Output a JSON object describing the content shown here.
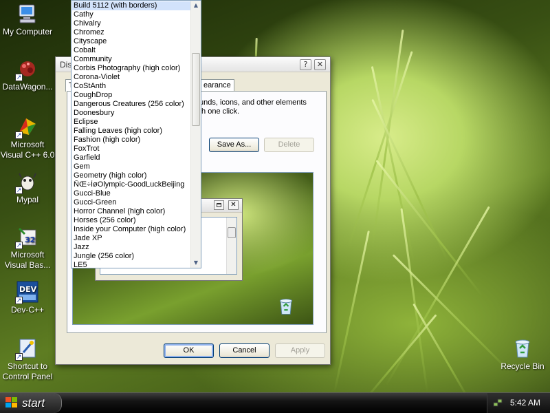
{
  "desktop": {
    "icons": [
      {
        "label": "My Computer",
        "icon": "my-computer-icon"
      },
      {
        "label": "DataWagon...",
        "icon": "datawagon-icon"
      },
      {
        "label": "Microsoft Visual C++ 6.0",
        "icon": "visual-cpp-icon"
      },
      {
        "label": "Mypal",
        "icon": "mypal-icon"
      },
      {
        "label": "Microsoft Visual Bas...",
        "icon": "visual-basic-icon"
      },
      {
        "label": "Dev-C++",
        "icon": "dev-cpp-icon"
      },
      {
        "label": "Shortcut to Control Panel",
        "icon": "control-panel-icon"
      },
      {
        "label": "Recycle Bin",
        "icon": "recycle-bin-icon"
      }
    ]
  },
  "dialog": {
    "title": "Dis",
    "help_button": "?",
    "close_button": "✕",
    "tab_left_fragment": "T",
    "tab_appearance_fragment": "earance",
    "description_line1": "unds, icons, and other elements",
    "description_line2": "th one click.",
    "save_as_label": "Save As...",
    "delete_label": "Delete",
    "ok_label": "OK",
    "cancel_label": "Cancel",
    "apply_label": "Apply"
  },
  "theme_dropdown": {
    "selected": "Build 5112 (with borders)",
    "options": [
      "Build 5112 (with borders)",
      "Cathy",
      "Chivalry",
      "Chromez",
      "Cityscape",
      "Cobalt",
      "Community",
      "Corbis Photography (high color)",
      "Corona-Violet",
      "CoStAnth",
      "CoughDrop",
      "Dangerous Creatures (256 color)",
      "Doonesbury",
      "Eclipse",
      "Falling Leaves (high color)",
      "Fashion (high color)",
      "FoxTrot",
      "Garfield",
      "Gem",
      "Geometry (high color)",
      "ÑŒ÷ÌøOlympic-GoodLuckBeijing",
      "Gucci-Blue",
      "Gucci-Green",
      "Horror Channel (high color)",
      "Horses (256 color)",
      "Inside your Computer (high color)",
      "Jade XP",
      "Jazz",
      "Jungle (256 color)",
      "LE5"
    ]
  },
  "taskbar": {
    "start_label": "start",
    "clock": "5:42 AM"
  },
  "colors": {
    "selection": "#d2e2fb",
    "dialog_face": "#ece9d8",
    "taskbar": "#141414"
  }
}
